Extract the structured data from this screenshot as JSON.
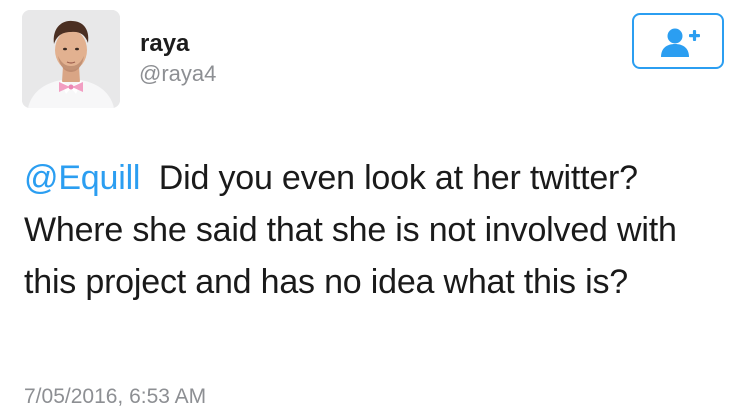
{
  "user": {
    "display_name": "raya",
    "handle": "@raya4"
  },
  "follow_button": {
    "icon": "add-user-icon",
    "color": "#2b9ef1"
  },
  "tweet": {
    "mention": "@Equill",
    "text": "Did you even look at her twitter? Where she said that she is not involved with this project and has no idea what this is?",
    "timestamp": "7/05/2016, 6:53 AM"
  },
  "colors": {
    "accent": "#2b9ef1",
    "secondary_text": "#8d8f93",
    "primary_text": "#1a1a1a"
  }
}
